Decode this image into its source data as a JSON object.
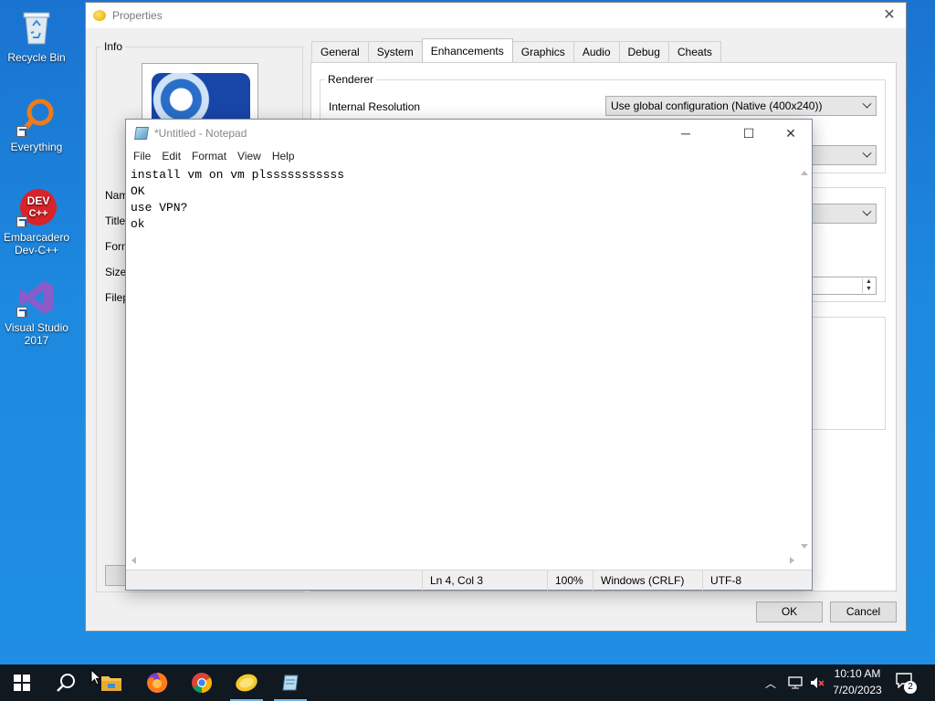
{
  "desktop": {
    "icons": [
      {
        "label": "Recycle Bin"
      },
      {
        "label": "Everything"
      },
      {
        "label": "Embarcadero Dev-C++",
        "glyph": "DEV C++"
      },
      {
        "label": "Visual Studio 2017"
      }
    ]
  },
  "properties": {
    "title": "Properties",
    "info_group": "Info",
    "info_labels": [
      "Nam",
      "Title",
      "Form",
      "Size",
      "Filep"
    ],
    "tabs": [
      "General",
      "System",
      "Enhancements",
      "Graphics",
      "Audio",
      "Debug",
      "Cheats"
    ],
    "active_tab": "Enhancements",
    "renderer_group": "Renderer",
    "internal_resolution_label": "Internal Resolution",
    "internal_resolution_value": "Use global configuration (Native (400x240))",
    "ok_label": "OK",
    "cancel_label": "Cancel"
  },
  "notepad": {
    "title": "*Untitled - Notepad",
    "menu": [
      "File",
      "Edit",
      "Format",
      "View",
      "Help"
    ],
    "content": "install vm on vm plsssssssssss\nOK\nuse VPN?\nok",
    "status": {
      "position": "Ln 4, Col 3",
      "zoom": "100%",
      "line_ending": "Windows (CRLF)",
      "encoding": "UTF-8"
    }
  },
  "taskbar": {
    "time": "10:10 AM",
    "date": "7/20/2023",
    "notification_count": "2"
  },
  "colors": {
    "desktop": "#1a73d0",
    "taskbar": "#101820",
    "accent": "#0078d7"
  }
}
